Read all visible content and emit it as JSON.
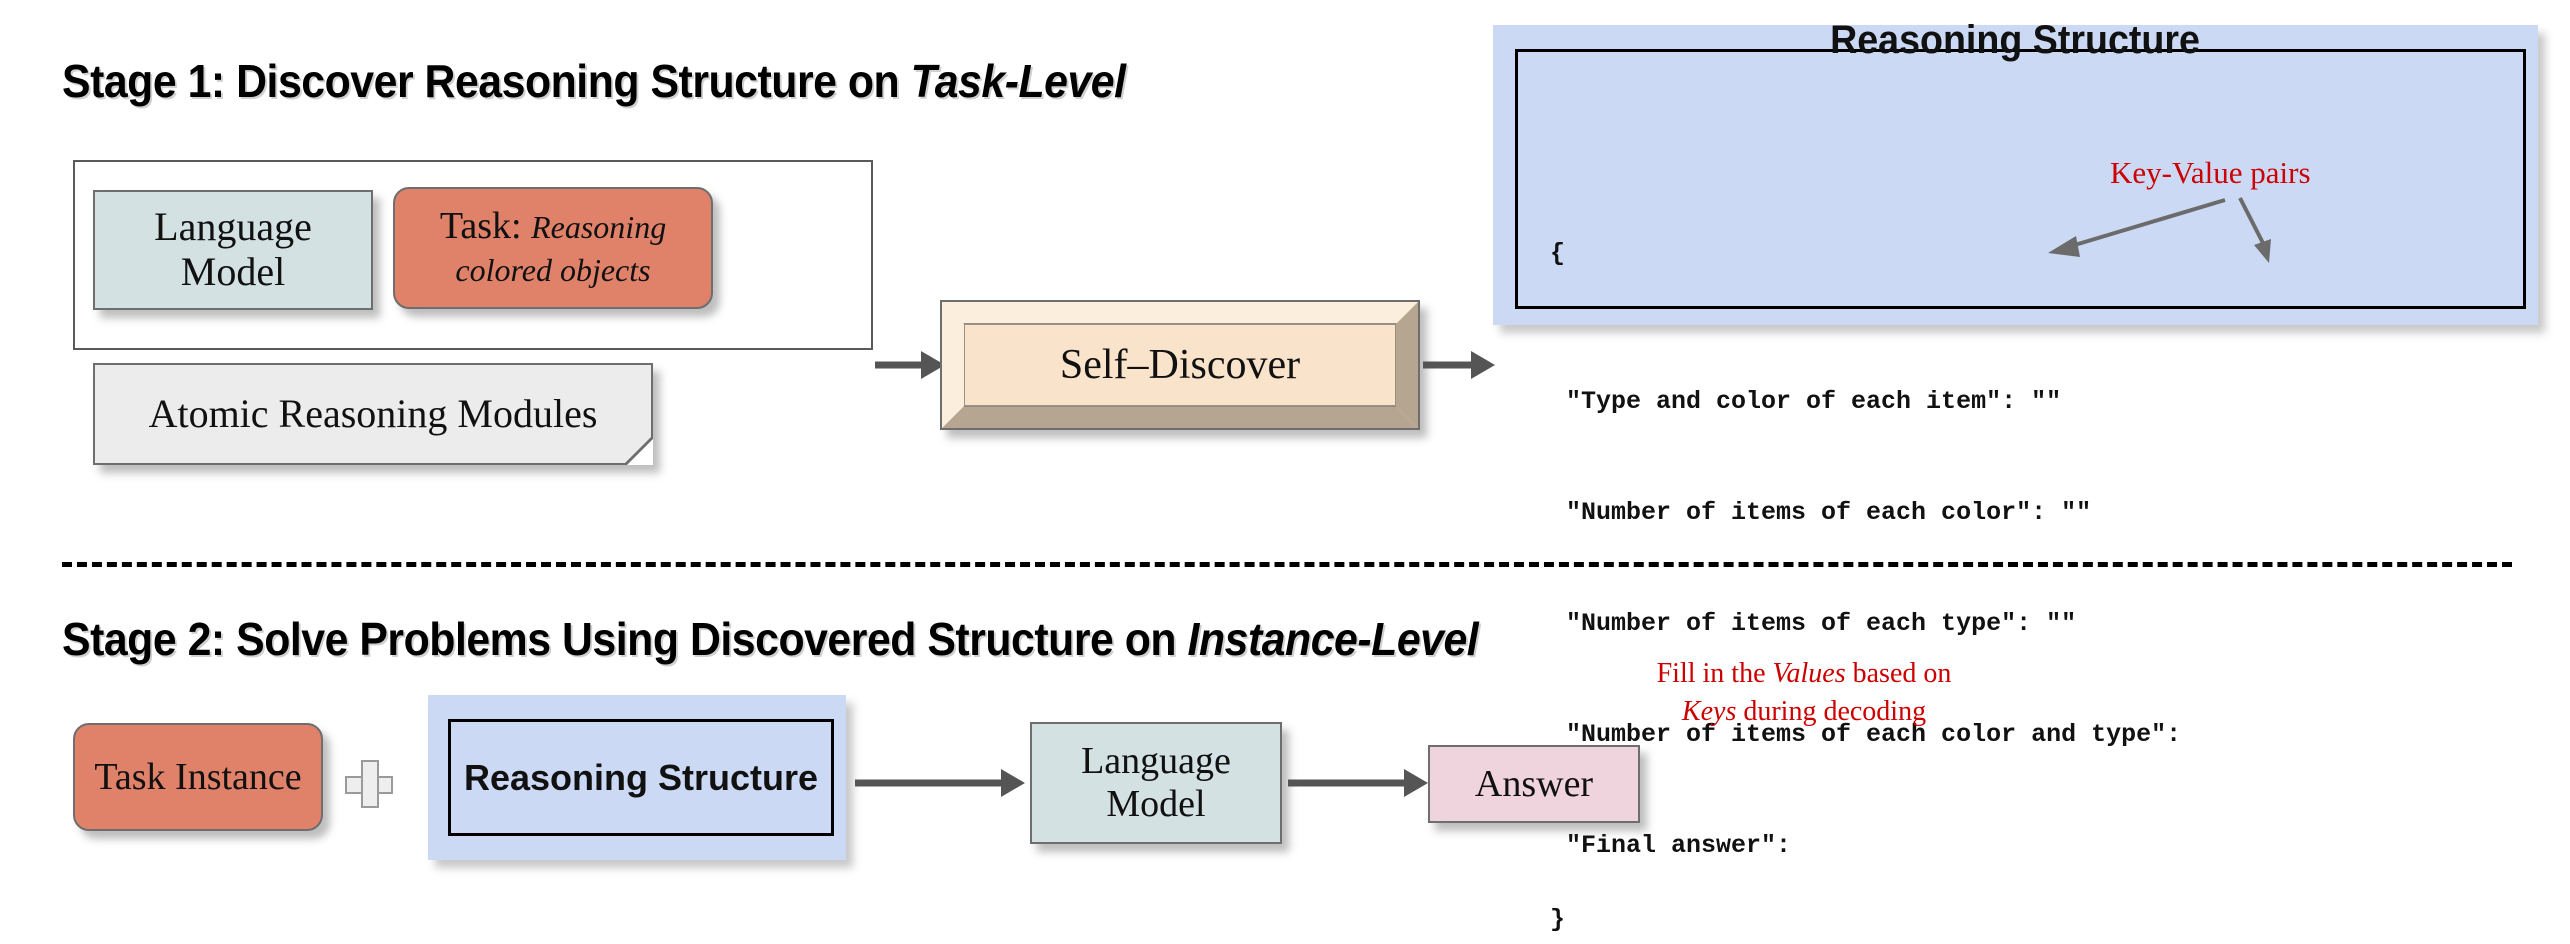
{
  "stage1": {
    "title_prefix": "Stage 1: Discover Reasoning Structure on ",
    "title_emphasis": "Task-Level",
    "language_model_line1": "Language",
    "language_model_line2": "Model",
    "task_label": "Task:",
    "task_value_line1": "Reasoning",
    "task_value_line2": "colored objects",
    "modules_label": "Atomic Reasoning Modules",
    "self_discover_label": "Self–Discover"
  },
  "reasoning_structure_panel": {
    "heading": "Reasoning Structure",
    "annotation": "Key-Value pairs",
    "code_open": "{",
    "code_lines": [
      "\"Type and color of each item\": \"\"",
      "\"Number of items of each color\": \"\"",
      "\"Number of items of each type\": \"\"",
      "\"Number of items of each color and type\":",
      "\"Final answer\":"
    ],
    "code_close": "}"
  },
  "stage2": {
    "title_prefix": "Stage 2: Solve Problems Using Discovered Structure on ",
    "title_emphasis": "Instance-Level",
    "task_instance_label": "Task Instance",
    "plus_icon": "plus-icon",
    "reasoning_structure_label": "Reasoning Structure",
    "language_model_line1": "Language",
    "language_model_line2": "Model",
    "answer_label": "Answer",
    "annotation_line1_a": "Fill in the ",
    "annotation_line1_em": "Values",
    "annotation_line1_b": " based on",
    "annotation_line2_em": "Keys",
    "annotation_line2_b": " during decoding"
  },
  "colors": {
    "language_model": "#d4e1e3",
    "task": "#e0816a",
    "modules": "#ececec",
    "self_discover": "#f6e2c9",
    "reasoning_structure": "#ccd9f5",
    "answer": "#efd4dd",
    "annotation_red": "#cc0000",
    "arrow_gray": "#555555"
  }
}
